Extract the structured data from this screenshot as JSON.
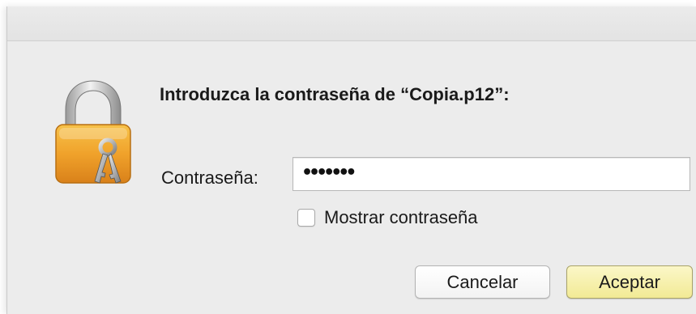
{
  "dialog": {
    "prompt": "Introduzca la contraseña de “Copia.p12”:",
    "password_label": "Contraseña:",
    "password_value": "•••••••",
    "show_password_label": "Mostrar contraseña",
    "show_password_checked": false,
    "cancel_label": "Cancelar",
    "accept_label": "Aceptar",
    "icon": "keychain-lock-icon"
  },
  "colors": {
    "window_bg": "#ececec",
    "default_button": "#f5eea6",
    "lock_body": "#f0a834"
  }
}
